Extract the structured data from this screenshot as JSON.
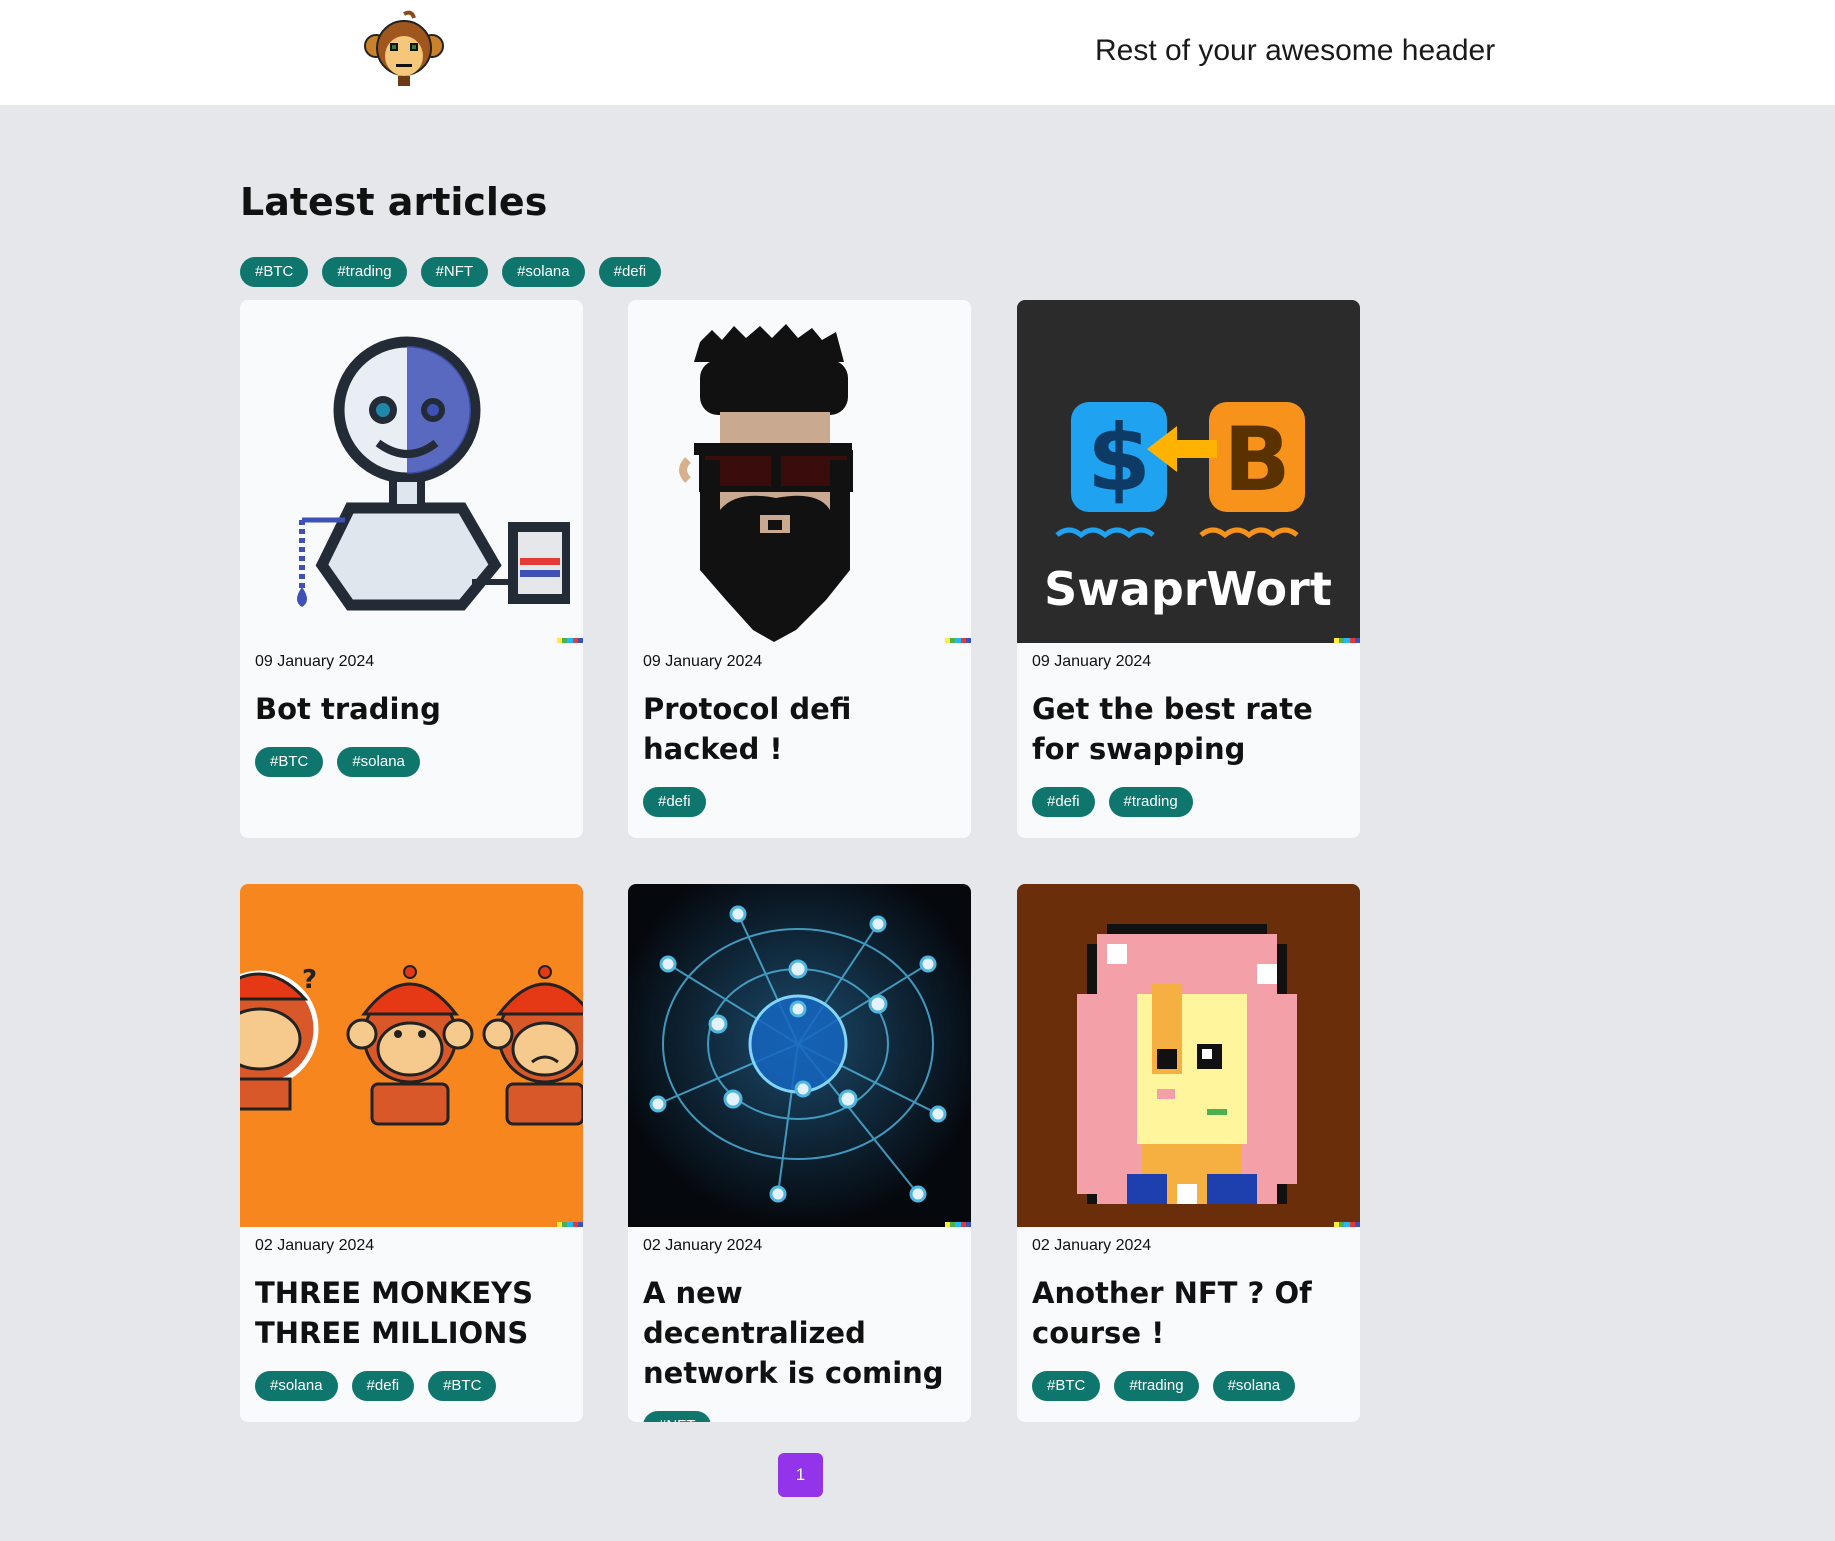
{
  "header": {
    "text": "Rest of your awesome header"
  },
  "page": {
    "title": "Latest articles"
  },
  "filter_tags": [
    "#BTC",
    "#trading",
    "#NFT",
    "#solana",
    "#defi"
  ],
  "articles": [
    {
      "date": "09 January 2024",
      "title": "Bot trading",
      "tags": [
        "#BTC",
        "#solana"
      ]
    },
    {
      "date": "09 January 2024",
      "title": "Protocol defi hacked !",
      "tags": [
        "#defi"
      ]
    },
    {
      "date": "09 January 2024",
      "title": "Get the best rate for swapping",
      "tags": [
        "#defi",
        "#trading"
      ],
      "image_text": "SwaprWort"
    },
    {
      "date": "02 January 2024",
      "title": "THREE MONKEYS THREE MILLIONS",
      "tags": [
        "#solana",
        "#defi",
        "#BTC"
      ]
    },
    {
      "date": "02 January 2024",
      "title": "A new decentralized network is coming",
      "tags": [
        "#NFT"
      ]
    },
    {
      "date": "02 January 2024",
      "title": "Another NFT ? Of course !",
      "tags": [
        "#BTC",
        "#trading",
        "#solana"
      ]
    }
  ],
  "pagination": {
    "current": "1"
  },
  "colors": {
    "tag_bg": "#0f766e",
    "pager_bg": "#9333ea",
    "page_bg": "#e5e7eb"
  }
}
